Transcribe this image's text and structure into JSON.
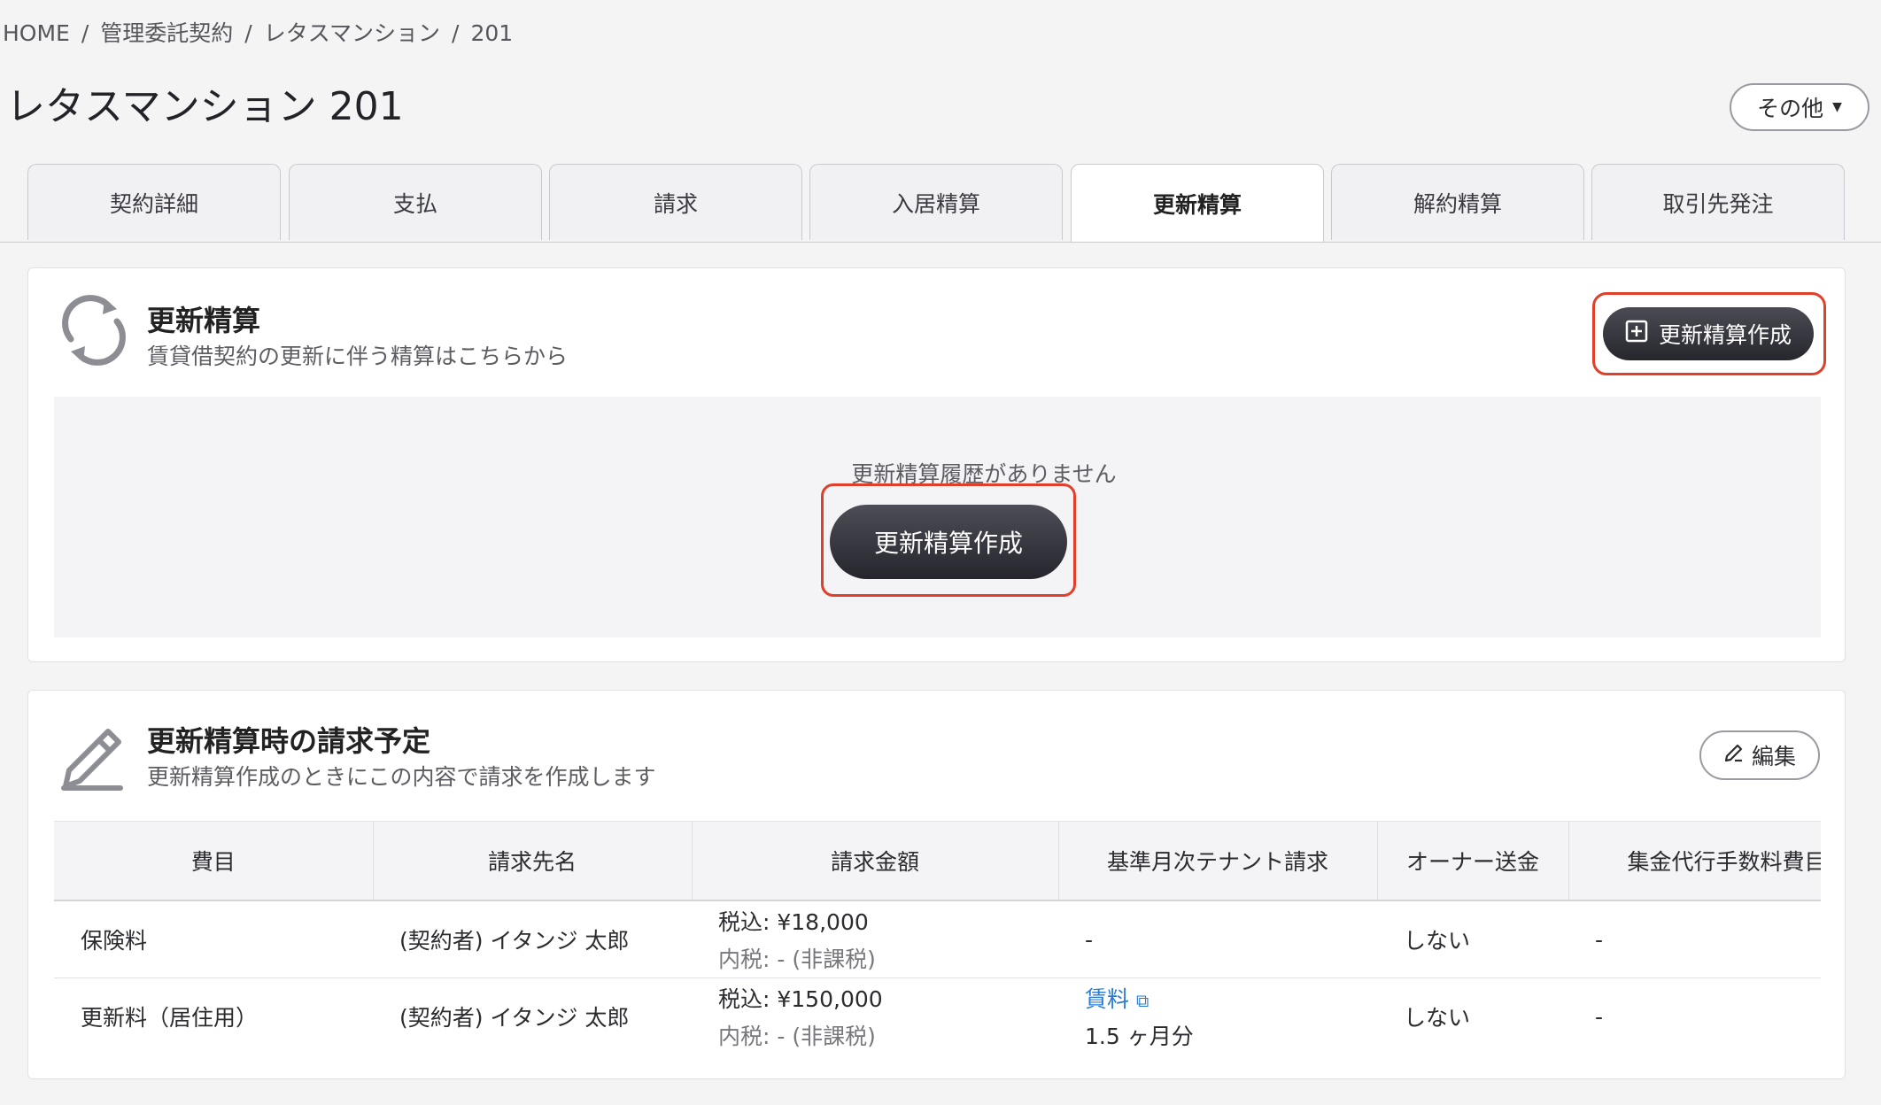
{
  "breadcrumb": {
    "items": [
      "HOME",
      "管理委託契約",
      "レタスマンション",
      "201"
    ],
    "separator": "/"
  },
  "page_title": "レタスマンション 201",
  "other_button": {
    "label": "その他"
  },
  "tabs": [
    {
      "label": "契約詳細"
    },
    {
      "label": "支払"
    },
    {
      "label": "請求"
    },
    {
      "label": "入居精算"
    },
    {
      "label": "更新精算"
    },
    {
      "label": "解約精算"
    },
    {
      "label": "取引先発注"
    }
  ],
  "active_tab": "更新精算",
  "renewal_section": {
    "title": "更新精算",
    "subtitle": "賃貸借契約の更新に伴う精算はこちらから",
    "create_button": "更新精算作成",
    "empty_message": "更新精算履歴がありません",
    "empty_create_button": "更新精算作成",
    "icon": "refresh-icon"
  },
  "billing_section": {
    "title": "更新精算時の請求予定",
    "subtitle": "更新精算作成のときにこの内容で請求を作成します",
    "edit_button": "編集",
    "icon": "pencil-icon",
    "columns": [
      "費目",
      "請求先名",
      "請求金額",
      "基準月次テナント請求",
      "オーナー送金",
      "集金代行手数料費目"
    ],
    "rows": [
      {
        "item": "保険料",
        "payee": "(契約者) イタンジ 太郎",
        "amount_incl": "税込: ¥18,000",
        "amount_tax": "内税: - (非課税)",
        "base_monthly": "-",
        "base_monthly_note": "",
        "owner_remit": "しない",
        "fee_item": "-"
      },
      {
        "item": "更新料（居住用）",
        "payee": "(契約者) イタンジ 太郎",
        "amount_incl": "税込: ¥150,000",
        "amount_tax": "内税: - (非課税)",
        "base_monthly": "賃料",
        "base_monthly_note": "1.5 ヶ月分",
        "owner_remit": "しない",
        "fee_item": "-"
      }
    ]
  },
  "colors": {
    "highlight": "#e0402a",
    "primary_button": "#2f2f36",
    "link": "#2a7bd3"
  }
}
